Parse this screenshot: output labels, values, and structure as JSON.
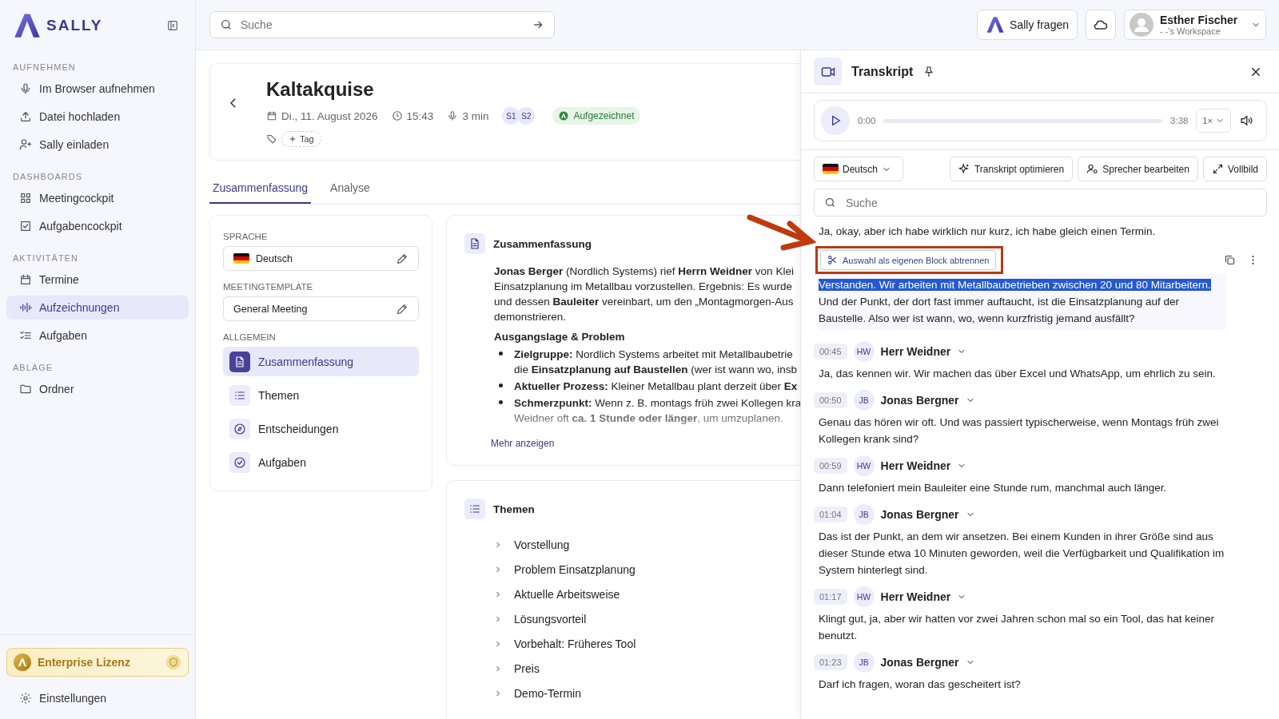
{
  "app": {
    "logo": "SALLY"
  },
  "sidebar": {
    "sections": [
      {
        "title": "AUFNEHMEN",
        "items": [
          {
            "label": "Im Browser aufnehmen",
            "selected": false
          },
          {
            "label": "Datei hochladen",
            "selected": false
          },
          {
            "label": "Sally einladen",
            "selected": false
          }
        ]
      },
      {
        "title": "DASHBOARDS",
        "items": [
          {
            "label": "Meetingcockpit",
            "selected": false
          },
          {
            "label": "Aufgabencockpit",
            "selected": false
          }
        ]
      },
      {
        "title": "AKTIVITÄTEN",
        "items": [
          {
            "label": "Termine",
            "selected": false
          },
          {
            "label": "Aufzeichnungen",
            "selected": true
          },
          {
            "label": "Aufgaben",
            "selected": false
          }
        ]
      },
      {
        "title": "ABLAGE",
        "items": [
          {
            "label": "Ordner",
            "selected": false
          }
        ]
      }
    ],
    "license": "Enterprise Lizenz",
    "settings": "Einstellungen"
  },
  "topbar": {
    "search": {
      "placeholder": "Suche"
    },
    "ask_button": "Sally fragen",
    "user": {
      "name": "Esther Fischer",
      "workspace": "- -'s Workspace"
    }
  },
  "meeting": {
    "title": "Kaltakquise",
    "date": "Di., 11. August 2026",
    "time": "15:43",
    "duration": "3 min",
    "speakers": [
      "S1",
      "S2"
    ],
    "status": "Aufgezeichnet",
    "add_tag": "Tag"
  },
  "tabs": [
    {
      "label": "Zusammenfassung",
      "selected": true
    },
    {
      "label": "Analyse",
      "selected": false
    }
  ],
  "settings_panel": {
    "language": {
      "label": "SPRACHE",
      "value": "Deutsch"
    },
    "template": {
      "label": "MEETINGTEMPLATE",
      "value": "General Meeting"
    },
    "section": "ALLGEMEIN",
    "items": [
      {
        "label": "Zusammenfassung",
        "selected": true
      },
      {
        "label": "Themen",
        "selected": false
      },
      {
        "label": "Entscheidungen",
        "selected": false
      },
      {
        "label": "Aufgaben",
        "selected": false
      }
    ]
  },
  "summary": {
    "title": "Zusammenfassung",
    "paragraph_lines": [
      "**Jonas Berger** (Nordlich Systems) rief **Herrn Weidner** von Klei",
      "Einsatzplanung im Metallbau vorzustellen. Ergebnis: Es wurde",
      "und dessen **Bauleiter** vereinbart, um den „Montagmorgen-Aus",
      "demonstrieren."
    ],
    "heading": "Ausgangslage & Problem",
    "bullets": [
      {
        "lines": [
          "**Zielgruppe:** Nordlich Systems arbeitet mit Metallbaubetrie",
          "die **Einsatzplanung auf Baustellen** (wer ist wann wo, insb"
        ]
      },
      {
        "lines": [
          "**Aktueller Prozess:** Kleiner Metallbau plant derzeit über **Ex**"
        ]
      },
      {
        "lines": [
          "**Schmerzpunkt:** Wenn z. B. montags früh zwei Kollegen kra",
          "Weidner oft **ca. 1 Stunde oder länger**, um umzuplanen."
        ]
      }
    ],
    "more": "Mehr anzeigen"
  },
  "topics": {
    "title": "Themen",
    "items": [
      {
        "label": "Vorstellung",
        "expanded": false
      },
      {
        "label": "Problem Einsatzplanung",
        "expanded": false
      },
      {
        "label": "Aktuelle Arbeitsweise",
        "expanded": false
      },
      {
        "label": "Lösungsvorteil",
        "expanded": false
      },
      {
        "label": "Vorbehalt: Früheres Tool",
        "expanded": false
      },
      {
        "label": "Preis",
        "expanded": false
      },
      {
        "label": "Demo-Termin",
        "expanded": false
      }
    ]
  },
  "transcript": {
    "title": "Transkript",
    "player": {
      "position": "0:00",
      "duration": "3:38",
      "speed": "1×",
      "level": 0
    },
    "language": "Deutsch",
    "actions": [
      "Transkript optimieren",
      "Sprecher bearbeiten",
      "Vollbild"
    ],
    "search": {
      "placeholder": "Suche"
    },
    "entries": [
      {
        "kind": "continuation",
        "text": "Ja, okay, aber ich habe wirklich nur kurz, ich habe gleich einen Termin."
      },
      {
        "kind": "selection",
        "action": "Auswahl als eigenen Block abtrennen",
        "selected_text": "Verstanden. Wir arbeiten mit Metallbaubetrieben zwischen 20 und 80 Mitarbeitern.",
        "text": "Und der Punkt, der dort fast immer auftaucht, ist die Einsatzplanung auf der Baustelle. Also wer ist wann, wo, wenn kurzfristig jemand ausfällt?"
      },
      {
        "kind": "speaker",
        "time": "00:45",
        "initials": "HW",
        "speaker": "Herr Weidner",
        "text": "Ja, das kennen wir. Wir machen das über Excel und WhatsApp, um ehrlich zu sein."
      },
      {
        "kind": "speaker",
        "time": "00:50",
        "initials": "JB",
        "speaker": "Jonas Bergner",
        "text": "Genau das hören wir oft. Und was passiert typischerweise, wenn Montags früh zwei Kollegen krank sind?"
      },
      {
        "kind": "speaker",
        "time": "00:59",
        "initials": "HW",
        "speaker": "Herr Weidner",
        "text": "Dann telefoniert mein Bauleiter eine Stunde rum, manchmal auch länger."
      },
      {
        "kind": "speaker",
        "time": "01:04",
        "initials": "JB",
        "speaker": "Jonas Bergner",
        "text": "Das ist der Punkt, an dem wir ansetzen. Bei einem Kunden in ihrer Größe sind aus dieser Stunde etwa 10 Minuten geworden, weil die Verfügbarkeit und Qualifikation im System hinterlegt sind."
      },
      {
        "kind": "speaker",
        "time": "01:17",
        "initials": "HW",
        "speaker": "Herr Weidner",
        "text": "Klingt gut, ja, aber wir hatten vor zwei Jahren schon mal so ein Tool, das hat keiner benutzt."
      },
      {
        "kind": "speaker",
        "time": "01:23",
        "initials": "JB",
        "speaker": "Jonas Bergner",
        "text": "Darf ich fragen, woran das gescheitert ist?"
      }
    ]
  }
}
